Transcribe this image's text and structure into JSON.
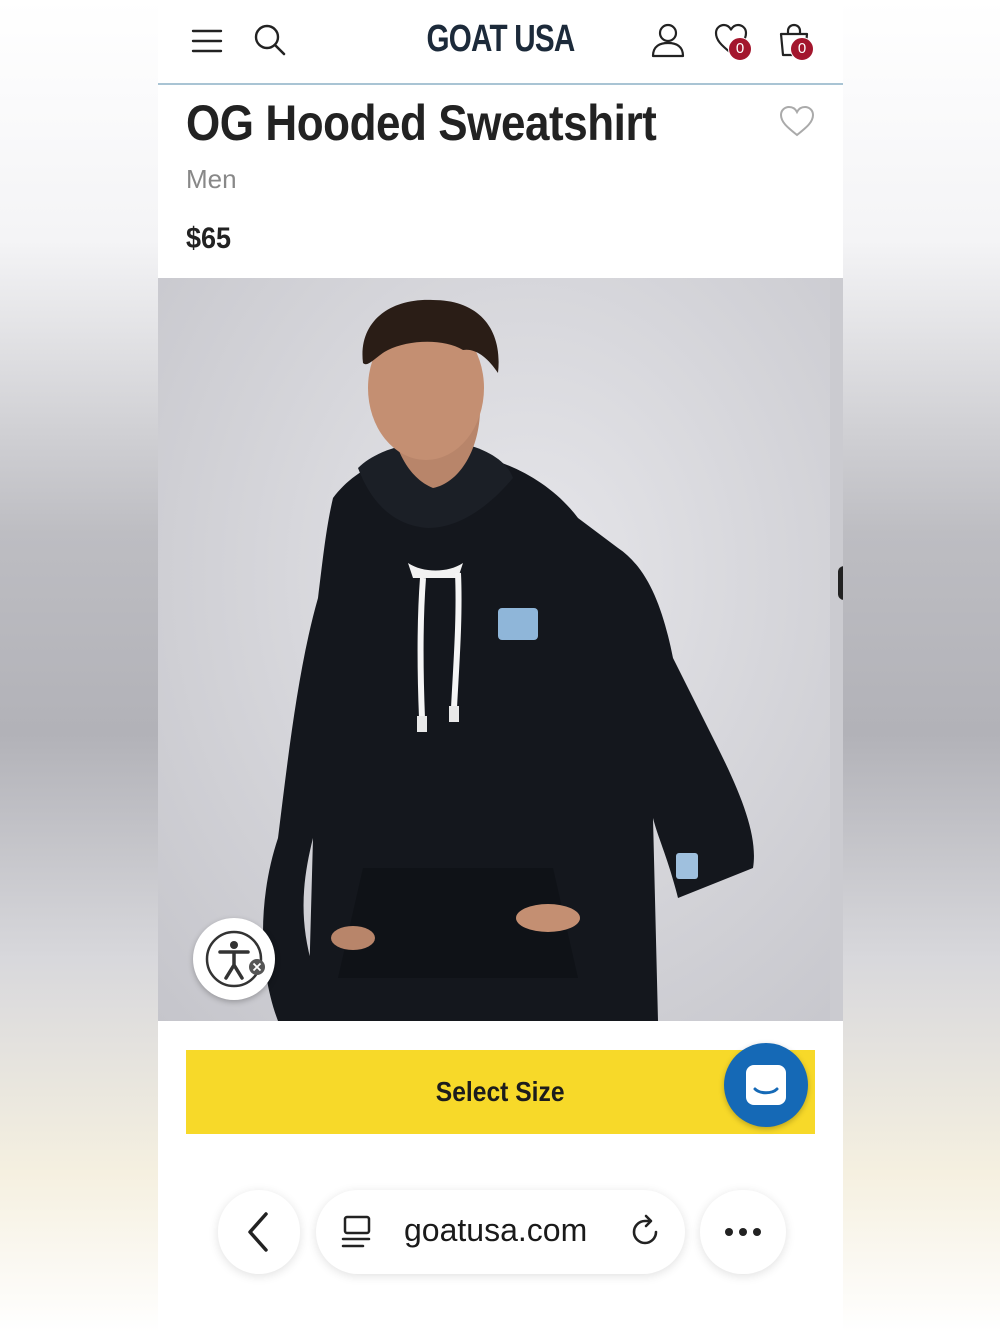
{
  "header": {
    "logo": "GOAT USA",
    "wishlist_count": "0",
    "cart_count": "0",
    "badge_color": "#a3162d"
  },
  "product": {
    "title": "OG Hooded Sweatshirt",
    "category": "Men",
    "price": "$65"
  },
  "actions": {
    "select_size_label": "Select Size",
    "button_color": "#f7d929",
    "chat_color": "#1569b6"
  },
  "browser": {
    "url": "goatusa.com"
  },
  "icons": [
    "hamburger-menu-icon",
    "search-icon",
    "account-icon",
    "wishlist-heart-icon",
    "shopping-bag-icon",
    "favorite-heart-icon",
    "accessibility-icon",
    "chat-icon",
    "back-chevron-icon",
    "tabs-icon",
    "reload-icon",
    "more-icon"
  ]
}
